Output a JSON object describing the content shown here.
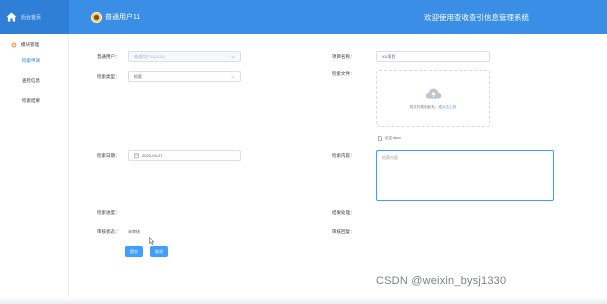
{
  "header": {
    "brand_text": "后台首页",
    "user_name": "普通用户11",
    "site_title": "欢迎使用查收查引信息管理系统"
  },
  "sidebar": {
    "group_label": "模块管理",
    "items": [
      {
        "label": "检索申请",
        "active": true
      },
      {
        "label": "查检信息"
      },
      {
        "label": "检索结果"
      }
    ]
  },
  "form": {
    "user_label": "普通用户：",
    "user_value": "普通用户11(1111)",
    "project_label": "项目名称：",
    "project_value": "XX项目",
    "type_label": "检索类型：",
    "type_value": "检索",
    "file_label": "检索文件：",
    "upload_hint": "将文件拖到此处，或",
    "upload_link": "点击上传",
    "file_name": "论文.docx",
    "date_label": "检索日期：",
    "date_value": "2023-04-27",
    "content_label": "检索内容：",
    "content_value": "检索内容",
    "progress_label": "检索进度：",
    "result_label": "结果处理：",
    "status_label": "审核状态：",
    "status_value": "未审核",
    "reply_label": "审核回复："
  },
  "buttons": {
    "submit": "提交",
    "cancel": "取消"
  },
  "icons": {
    "home": "home-icon",
    "avatar": "avatar-icon",
    "gear": "gear-icon",
    "caret": "chevron-down-icon",
    "calendar": "calendar-icon",
    "upload": "cloud-upload-icon",
    "document": "document-icon",
    "cursor": "mouse-cursor-icon"
  },
  "colors": {
    "header": "#3a8ee6",
    "brand": "#2f7fd6",
    "accent": "#409eff",
    "active_menu": "#2a7ce0"
  },
  "watermark": "CSDN @weixin_bysj1330"
}
